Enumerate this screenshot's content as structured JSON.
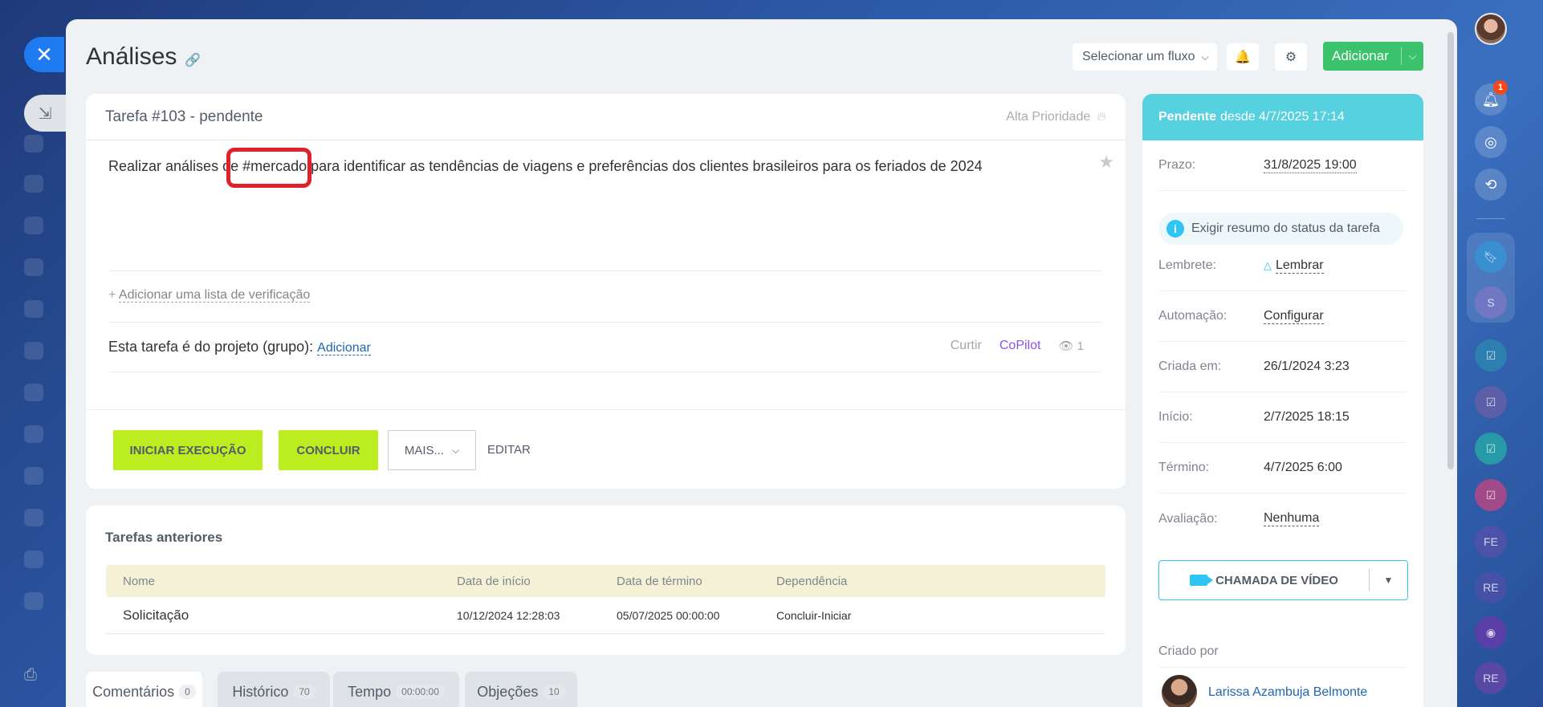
{
  "header": {
    "title": "Análises",
    "flow_select": "Selecionar um fluxo",
    "add_label": "Adicionar"
  },
  "task": {
    "number": "Tarefa #103 - pendente",
    "priority": "Alta Prioridade",
    "description": "Realizar análises de #mercado para identificar as tendências de viagens e preferências dos clientes brasileiros para os feriados de 2024",
    "checklist_link": "Adicionar uma lista de verificação",
    "project_label": "Esta tarefa é do projeto (grupo):",
    "project_add": "Adicionar",
    "like": "Curtir",
    "copilot": "CoPilot",
    "views": "1",
    "btn_start": "INICIAR EXECUÇÃO",
    "btn_finish": "CONCLUIR",
    "btn_more": "MAIS...",
    "btn_edit": "EDITAR"
  },
  "previous": {
    "title": "Tarefas anteriores",
    "columns": [
      "Nome",
      "Data de início",
      "Data de término",
      "Dependência"
    ],
    "rows": [
      [
        "Solicitação",
        "10/12/2024 12:28:03",
        "05/07/2025 00:00:00",
        "Concluir-Iniciar"
      ]
    ]
  },
  "tabs": [
    {
      "label": "Comentários",
      "count": "0"
    },
    {
      "label": "Histórico",
      "count": "70"
    },
    {
      "label": "Tempo",
      "count": "00:00:00"
    },
    {
      "label": "Objeções",
      "count": "10"
    }
  ],
  "side": {
    "status_bold": "Pendente",
    "status_rest": "desde 4/7/2025 17:14",
    "deadline_k": "Prazo:",
    "deadline_v": "31/8/2025 19:00",
    "summary": "Exigir resumo do status da tarefa",
    "reminder_k": "Lembrete:",
    "reminder_v": "Lembrar",
    "automation_k": "Automação:",
    "automation_v": "Configurar",
    "created_k": "Criada em:",
    "created_v": "26/1/2024 3:23",
    "start_k": "Início:",
    "start_v": "2/7/2025 18:15",
    "end_k": "Término:",
    "end_v": "4/7/2025 6:00",
    "rating_k": "Avaliação:",
    "rating_v": "Nenhuma",
    "video_label": "CHAMADA DE VÍDEO",
    "created_by": "Criado por",
    "creator_name": "Larissa Azambuja Belmonte"
  },
  "right_bar": {
    "notif_count": "1",
    "s_label": "S",
    "fe_label": "FE",
    "re_label": "RE",
    "re2_label": "RE"
  }
}
